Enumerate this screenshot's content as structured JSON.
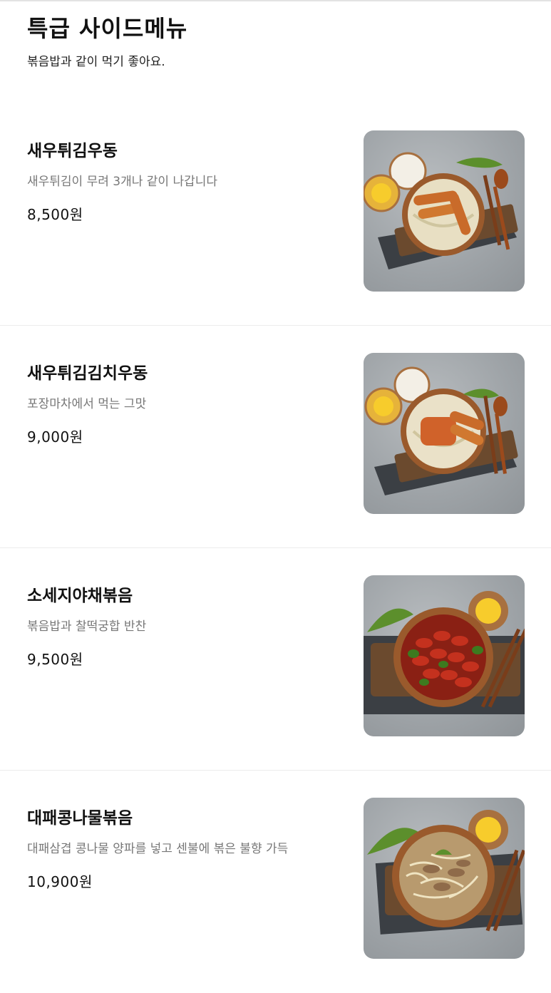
{
  "section": {
    "title": "특급 사이드메뉴",
    "subtitle": "볶음밥과 같이 먹기 좋아요."
  },
  "items": [
    {
      "name": "새우튀김우동",
      "description": "새우튀김이 무려 3개나 같이 나갑니다",
      "price": "8,500원",
      "photo_icon": "shrimp-tempura-udon-photo"
    },
    {
      "name": "새우튀김김치우동",
      "description": "포장마차에서 먹는 그맛",
      "price": "9,000원",
      "photo_icon": "shrimp-tempura-kimchi-udon-photo"
    },
    {
      "name": "소세지야채볶음",
      "description": "볶음밥과 찰떡궁합 반찬",
      "price": "9,500원",
      "photo_icon": "sausage-vegetable-stirfry-photo"
    },
    {
      "name": "대패콩나물볶음",
      "description": "대패삼겹 콩나물 양파를 넣고 센불에 볶은 불향 가득",
      "price": "10,900원",
      "photo_icon": "pork-beansprout-stirfry-photo"
    }
  ]
}
